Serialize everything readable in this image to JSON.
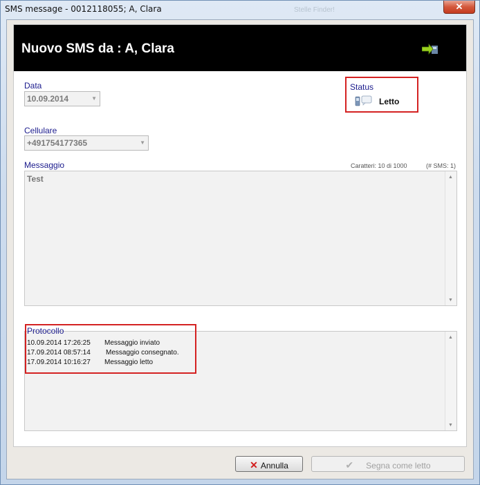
{
  "window": {
    "title": "SMS message - 0012118055; A, Clara",
    "ghost_text": "Stelle Finder!",
    "close_label": "✕"
  },
  "header": {
    "title_prefix": "Nuovo SMS",
    "title_suffix": "da : A, Clara",
    "forward_icon": "forward-arrow-icon"
  },
  "fields": {
    "data_label": "Data",
    "data_value": "10.09.2014",
    "cellulare_label": "Cellulare",
    "cellulare_value": "+491754177365",
    "messaggio_label": "Messaggio",
    "caratteri": "Caratteri: 10 di 1000",
    "sms_count": "(# SMS: 1)",
    "messaggio_value": "Test"
  },
  "status": {
    "label": "Status",
    "value": "Letto",
    "icon": "phone-message-icon"
  },
  "protocollo": {
    "label": "Protocollo",
    "entries": [
      {
        "ts": "10.09.2014 17:26:25",
        "msg": "Messaggio inviato"
      },
      {
        "ts": "17.09.2014 08:57:14",
        "msg": "Messaggio consegnato."
      },
      {
        "ts": "17.09.2014 10:16:27",
        "msg": "Messaggio letto"
      }
    ]
  },
  "buttons": {
    "cancel": "Annulla",
    "mark_read": "Segna come letto"
  },
  "colors": {
    "header_bg": "#000000",
    "label_color": "#1a1a8c",
    "highlight_border": "#d42121"
  }
}
